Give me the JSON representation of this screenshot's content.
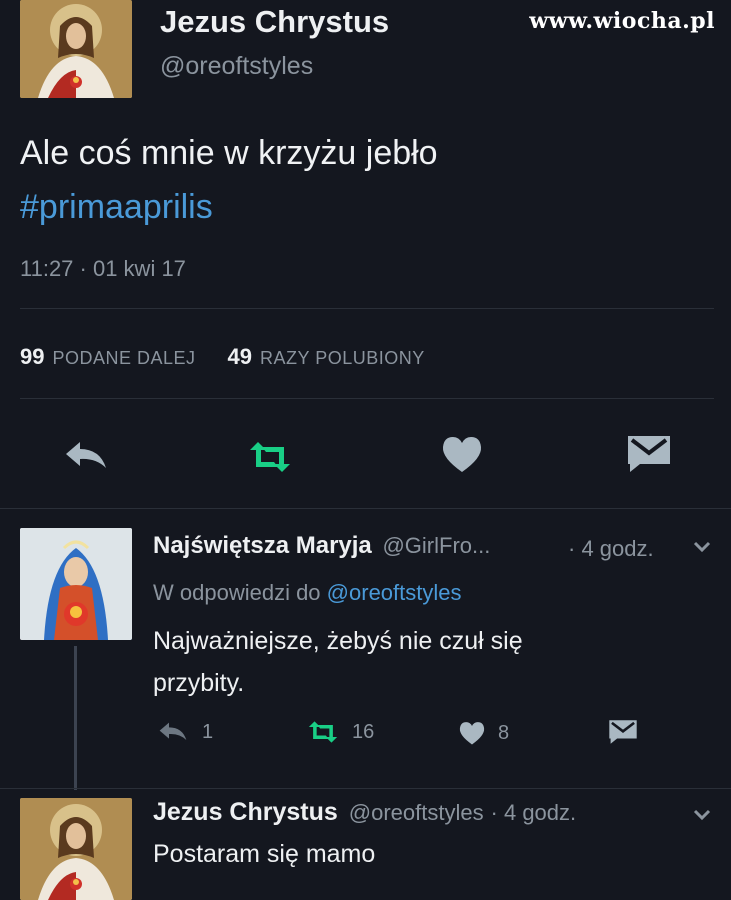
{
  "watermark": "www.wiocha.pl",
  "main_tweet": {
    "author_name": "Jezus Chrystus",
    "author_handle": "@oreoftstyles",
    "text": "Ale coś mnie w krzyżu jebło",
    "hashtag": "#primaaprilis",
    "timestamp": "11:27 · 01 kwi 17",
    "retweets_count": "99",
    "retweets_label": "PODANE DALEJ",
    "likes_count": "49",
    "likes_label": "RAZY POLUBIONY"
  },
  "reply_1": {
    "author_name": "Najświętsza Maryja",
    "author_handle": "@GirlFro...",
    "time": "· 4 godz.",
    "reply_to_prefix": "W odpowiedzi do",
    "reply_to_handle": "@oreoftstyles",
    "text_line1": "Najważniejsze, żebyś nie czuł się",
    "text_line2": "przybity.",
    "reply_count": "1",
    "retweet_count": "16",
    "like_count": "8"
  },
  "reply_2": {
    "author_name": "Jezus Chrystus",
    "author_handle": "@oreoftstyles",
    "time": "· 4 godz.",
    "text": "Postaram się mamo"
  },
  "colors": {
    "background": "#14171f",
    "link": "#4a9ad8",
    "retweet_green": "#19cf86",
    "icon_gray": "#aab8c2"
  }
}
